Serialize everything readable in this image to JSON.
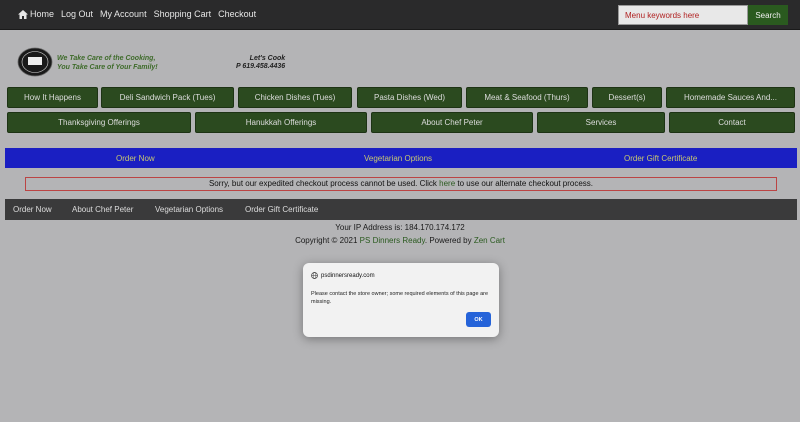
{
  "topnav": {
    "items": [
      "Home",
      "Log Out",
      "My Account",
      "Shopping Cart",
      "Checkout"
    ],
    "search_placeholder": "Menu keywords here",
    "search_button": "Search"
  },
  "header": {
    "tagline_1": "We Take Care of the Cooking,",
    "tagline_2": "You Take Care of Your Family!",
    "cook_label": "Let's Cook",
    "phone": "P 619.458.4436"
  },
  "categories": {
    "row1": [
      "How It Happens",
      "Deli Sandwich Pack (Tues)",
      "Chicken Dishes (Tues)",
      "Pasta Dishes (Wed)",
      "Meat & Seafood (Thurs)",
      "Dessert(s)",
      "Homemade Sauces And..."
    ],
    "row2": [
      "Thanksgiving Offerings",
      "Hanukkah Offerings",
      "About Chef Peter",
      "Services",
      "Contact"
    ]
  },
  "bluebar": [
    "Order Now",
    "Vegetarian Options",
    "Order Gift Certificate"
  ],
  "notice": {
    "before": "Sorry, but our expedited checkout process cannot be used. Click ",
    "link": "here",
    "after": " to use our alternate checkout process."
  },
  "footbar": [
    "Order Now",
    "About Chef Peter",
    "Vegetarian Options",
    "Order Gift Certificate"
  ],
  "footer": {
    "ip": "Your IP Address is: 184.170.174.172",
    "copy_prefix": "Copyright © 2021 ",
    "site_name": "PS Dinners Ready",
    "powered_prefix": ". Powered by ",
    "powered_by": "Zen Cart"
  },
  "dialog": {
    "domain": "psdinnersready.com",
    "message": "Please contact the store owner; some required elements of this page are missing.",
    "ok": "OK"
  },
  "colors": {
    "accent_green": "#2b4a1f",
    "blue_bar": "#1a1fc2",
    "ok_blue": "#2563d9"
  }
}
